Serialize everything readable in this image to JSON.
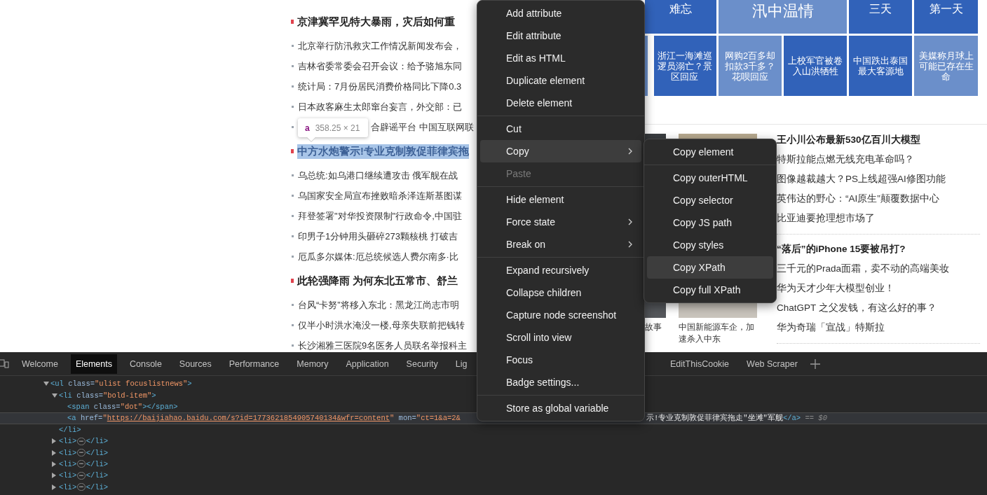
{
  "page": {
    "left_news": [
      {
        "kind": "headline",
        "text": "京津冀罕见特大暴雨，灾后如何重",
        "selected": false
      },
      {
        "kind": "item",
        "text": "北京举行防汛救灾工作情况新闻发布会，",
        "selected": false
      },
      {
        "kind": "item",
        "text": "吉林省委常委会召开会议：给予骆旭东同",
        "selected": false
      },
      {
        "kind": "item",
        "text": "统计局：7月份居民消费价格同比下降0.3",
        "selected": false
      },
      {
        "kind": "item",
        "text": "日本政客麻生太郎窜台妄言，外交部：已",
        "selected": false
      },
      {
        "kind": "item",
        "text": "合辟谣平台 中国互联网联",
        "selected": false,
        "covered_start": true
      },
      {
        "kind": "headline",
        "text": "中方水炮警示!专业克制敦促菲律宾拖",
        "selected": true
      },
      {
        "kind": "item",
        "text": "乌总统:如乌港口继续遭攻击 俄军舰在战",
        "selected": false
      },
      {
        "kind": "item",
        "text": "乌国家安全局宣布挫败暗杀泽连斯基图谋",
        "selected": false
      },
      {
        "kind": "item",
        "text": "拜登签署\"对华投资限制\"行政命令,中国驻",
        "selected": false
      },
      {
        "kind": "item",
        "text": "印男子1分钟用头砸碎273颗核桃 打破吉",
        "selected": false
      },
      {
        "kind": "item",
        "text": "厄瓜多尔媒体:厄总统候选人费尔南多·比",
        "selected": false
      },
      {
        "kind": "headline",
        "text": "此轮强降雨 为何东北五常市、舒兰",
        "selected": false
      },
      {
        "kind": "item",
        "text": "台风“卡努”将移入东北：黑龙江尚志市明",
        "selected": false
      },
      {
        "kind": "item",
        "text": "仅半小时洪水淹没一楼,母亲失联前把钱转",
        "selected": false
      },
      {
        "kind": "item",
        "text": "长沙湘雅三医院9名医务人员联名举报科主",
        "selected": false
      }
    ],
    "tile_rows": [
      [
        {
          "text": "难忘",
          "color": "#3162b9"
        },
        {
          "text": "汛中温情",
          "color": "#6b8fca",
          "wide": true
        },
        {
          "text": "三天",
          "color": "#3162b9"
        },
        {
          "text": "第一天",
          "color": "#3162b9"
        }
      ],
      [
        {
          "text": "浙江一海滩巡逻员溺亡？景区回应",
          "color": "#3162b9"
        },
        {
          "text": "网购2百多却扣款3千多？花呗回应",
          "color": "#6b8fca"
        },
        {
          "text": "上校军官被卷入山洪牺牲",
          "color": "#3162b9"
        },
        {
          "text": "中国跌出泰国最大客源地",
          "color": "#3162b9"
        },
        {
          "text": "美媒称月球上可能已存在生命",
          "color": "#6b8fca"
        }
      ]
    ],
    "mid_stories": [
      {
        "caption": "故事"
      },
      {
        "caption": "中国新能源车企，加速杀入中东"
      }
    ],
    "right_news": [
      {
        "headline": "王小川公布最新530亿百川大模型",
        "items": [
          "特斯拉能点燃无线充电革命吗？",
          "图像越裁越大？PS上线超强AI修图功能",
          "英伟达的野心：“AI原生”颠覆数据中心",
          "比亚迪要抢理想市场了"
        ]
      },
      {
        "headline": "“落后”的iPhone 15要被吊打?",
        "items": [
          "三千元的Prada面霜，卖不动的高端美妆",
          "华为天才少年大模型创业！",
          "ChatGPT 之父发钱，有这么好的事？",
          "华为奇瑞「宣战」特斯拉"
        ]
      }
    ]
  },
  "tooltip": {
    "tag": "a",
    "size": "358.25 × 21"
  },
  "context_menu": {
    "items": [
      {
        "kind": "item",
        "label": "Add attribute",
        "selected": false,
        "disabled": false,
        "has_submenu": false
      },
      {
        "kind": "item",
        "label": "Edit attribute",
        "selected": false,
        "disabled": false,
        "has_submenu": false
      },
      {
        "kind": "item",
        "label": "Edit as HTML",
        "selected": false,
        "disabled": false,
        "has_submenu": false
      },
      {
        "kind": "item",
        "label": "Duplicate element",
        "selected": false,
        "disabled": false,
        "has_submenu": false
      },
      {
        "kind": "item",
        "label": "Delete element",
        "selected": false,
        "disabled": false,
        "has_submenu": false
      },
      {
        "kind": "separator"
      },
      {
        "kind": "item",
        "label": "Cut",
        "selected": false,
        "disabled": false,
        "has_submenu": false
      },
      {
        "kind": "item",
        "label": "Copy",
        "selected": true,
        "disabled": false,
        "has_submenu": true
      },
      {
        "kind": "item",
        "label": "Paste",
        "selected": false,
        "disabled": true,
        "has_submenu": false
      },
      {
        "kind": "separator"
      },
      {
        "kind": "item",
        "label": "Hide element",
        "selected": false,
        "disabled": false,
        "has_submenu": false
      },
      {
        "kind": "item",
        "label": "Force state",
        "selected": false,
        "disabled": false,
        "has_submenu": true
      },
      {
        "kind": "item",
        "label": "Break on",
        "selected": false,
        "disabled": false,
        "has_submenu": true
      },
      {
        "kind": "separator"
      },
      {
        "kind": "item",
        "label": "Expand recursively",
        "selected": false,
        "disabled": false,
        "has_submenu": false
      },
      {
        "kind": "item",
        "label": "Collapse children",
        "selected": false,
        "disabled": false,
        "has_submenu": false
      },
      {
        "kind": "item",
        "label": "Capture node screenshot",
        "selected": false,
        "disabled": false,
        "has_submenu": false
      },
      {
        "kind": "item",
        "label": "Scroll into view",
        "selected": false,
        "disabled": false,
        "has_submenu": false
      },
      {
        "kind": "item",
        "label": "Focus",
        "selected": false,
        "disabled": false,
        "has_submenu": false
      },
      {
        "kind": "item",
        "label": "Badge settings...",
        "selected": false,
        "disabled": false,
        "has_submenu": false
      },
      {
        "kind": "separator"
      },
      {
        "kind": "item",
        "label": "Store as global variable",
        "selected": false,
        "disabled": false,
        "has_submenu": false
      }
    ]
  },
  "submenu": {
    "items": [
      {
        "kind": "item",
        "label": "Copy element",
        "selected": false,
        "disabled": false,
        "has_submenu": false
      },
      {
        "kind": "separator"
      },
      {
        "kind": "item",
        "label": "Copy outerHTML",
        "selected": false,
        "disabled": false,
        "has_submenu": false
      },
      {
        "kind": "item",
        "label": "Copy selector",
        "selected": false,
        "disabled": false,
        "has_submenu": false
      },
      {
        "kind": "item",
        "label": "Copy JS path",
        "selected": false,
        "disabled": false,
        "has_submenu": false
      },
      {
        "kind": "item",
        "label": "Copy styles",
        "selected": false,
        "disabled": false,
        "has_submenu": false
      },
      {
        "kind": "item",
        "label": "Copy XPath",
        "selected": true,
        "disabled": false,
        "has_submenu": false
      },
      {
        "kind": "item",
        "label": "Copy full XPath",
        "selected": false,
        "disabled": false,
        "has_submenu": false
      }
    ]
  },
  "devtools": {
    "tabs": [
      {
        "label": "Welcome",
        "selected": false
      },
      {
        "label": "Elements",
        "selected": true
      },
      {
        "label": "Console",
        "selected": false
      },
      {
        "label": "Sources",
        "selected": false
      },
      {
        "label": "Performance",
        "selected": false
      },
      {
        "label": "Memory",
        "selected": false
      },
      {
        "label": "Application",
        "selected": false
      },
      {
        "label": "Security",
        "selected": false
      },
      {
        "label": "Lig",
        "selected": false
      }
    ],
    "more_tabs": [
      {
        "label": "EditThisCookie",
        "selected": false
      },
      {
        "label": "Web Scraper",
        "selected": false
      }
    ],
    "tree": [
      {
        "expanded": true,
        "selected": false,
        "parts": [
          {
            "kind": "tag",
            "text": "<ul"
          },
          {
            "kind": "attr",
            "text": " class="
          },
          {
            "kind": "value",
            "text": "\"ulist focuslistnews\""
          },
          {
            "kind": "tag",
            "text": ">"
          }
        ],
        "children": [
          {
            "expanded": true,
            "selected": false,
            "parts": [
              {
                "kind": "tag",
                "text": "<li"
              },
              {
                "kind": "attr",
                "text": " class="
              },
              {
                "kind": "value",
                "text": "\"bold-item\""
              },
              {
                "kind": "tag",
                "text": ">"
              }
            ],
            "children": [
              {
                "selected": false,
                "parts": [
                  {
                    "kind": "tag",
                    "text": "<span"
                  },
                  {
                    "kind": "attr",
                    "text": " class="
                  },
                  {
                    "kind": "value",
                    "text": "\"dot\""
                  },
                  {
                    "kind": "tag",
                    "text": "></span>"
                  }
                ]
              },
              {
                "selected": true,
                "parts": [
                  {
                    "kind": "tag",
                    "text": "<a"
                  },
                  {
                    "kind": "attr",
                    "text": " href="
                  },
                  {
                    "kind": "value",
                    "text": "\""
                  },
                  {
                    "kind": "link",
                    "text": "https://baijiahao.baidu.com/s?id=1773621854905740134&wfr=content"
                  },
                  {
                    "kind": "value",
                    "text": "\""
                  },
                  {
                    "kind": "attr",
                    "text": " mon="
                  },
                  {
                    "kind": "value",
                    "text": "\"ct=1&a=2&"
                  }
                ],
                "tail": [
                  {
                    "kind": "text",
                    "text": "示!专业克制敦促菲律宾拖走\"坐滩\"军舰"
                  },
                  {
                    "kind": "tag",
                    "text": "</a>"
                  },
                  {
                    "kind": "note",
                    "text": " == $0"
                  }
                ]
              }
            ],
            "close": [
              {
                "kind": "tag",
                "text": "</li>"
              }
            ]
          },
          {
            "expanded": false,
            "selected": false,
            "parts": [
              {
                "kind": "tag",
                "text": "<li>"
              },
              {
                "kind": "ellipsis",
                "text": "⋯"
              },
              {
                "kind": "tag",
                "text": "</li>"
              }
            ]
          },
          {
            "expanded": false,
            "selected": false,
            "parts": [
              {
                "kind": "tag",
                "text": "<li>"
              },
              {
                "kind": "ellipsis",
                "text": "⋯"
              },
              {
                "kind": "tag",
                "text": "</li>"
              }
            ]
          },
          {
            "expanded": false,
            "selected": false,
            "parts": [
              {
                "kind": "tag",
                "text": "<li>"
              },
              {
                "kind": "ellipsis",
                "text": "⋯"
              },
              {
                "kind": "tag",
                "text": "</li>"
              }
            ]
          },
          {
            "expanded": false,
            "selected": false,
            "parts": [
              {
                "kind": "tag",
                "text": "<li>"
              },
              {
                "kind": "ellipsis",
                "text": "⋯"
              },
              {
                "kind": "tag",
                "text": "</li>"
              }
            ]
          },
          {
            "expanded": false,
            "selected": false,
            "parts": [
              {
                "kind": "tag",
                "text": "<li>"
              },
              {
                "kind": "ellipsis",
                "text": "⋯"
              },
              {
                "kind": "tag",
                "text": "</li>"
              }
            ]
          }
        ]
      }
    ]
  }
}
